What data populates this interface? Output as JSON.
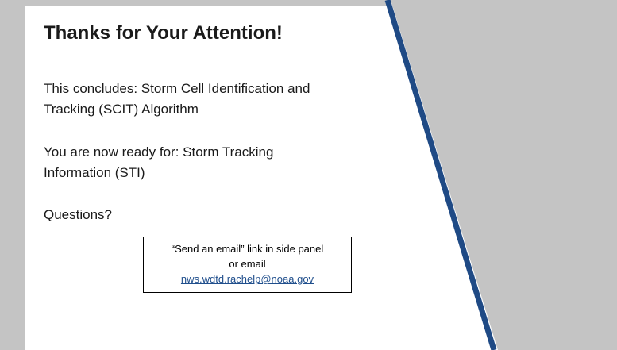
{
  "slide": {
    "title": "Thanks for Your Attention!",
    "concludes_line1": "This concludes: Storm Cell Identification and",
    "concludes_line2": "Tracking (SCIT) Algorithm",
    "ready_line1": "You are now ready for: Storm Tracking",
    "ready_line2": "Information (STI)",
    "questions": "Questions?"
  },
  "contact": {
    "line1": "“Send an email” link in side panel",
    "line2": "or email",
    "email": "nws.wdtd.rachelp@noaa.gov"
  },
  "colors": {
    "accent_stripe": "#1f4a85",
    "panel_gray": "#c4c4c4",
    "link": "#1f4e8c"
  }
}
